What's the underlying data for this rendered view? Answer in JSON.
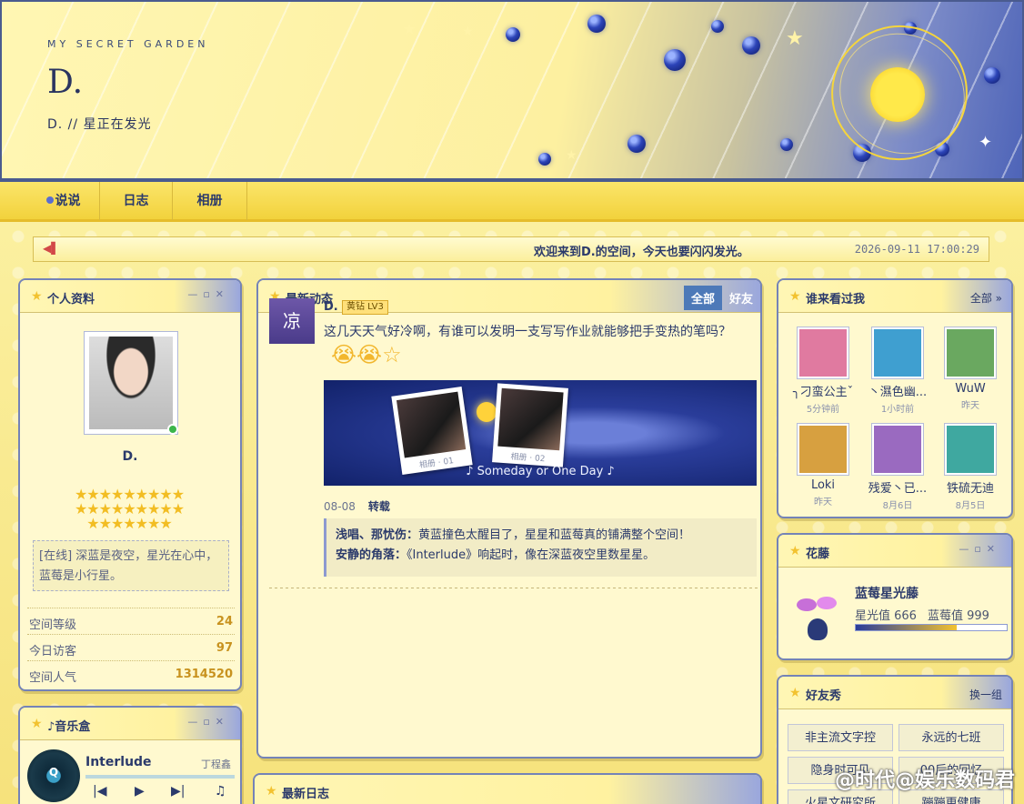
{
  "header": {
    "tagline": "MY SECRET GARDEN",
    "name": "D.",
    "subtitle": "D. // 星正在发光"
  },
  "nav": {
    "items": [
      "说说",
      "日志",
      "相册"
    ]
  },
  "marquee": {
    "text": "欢迎来到D.的空间，今天也要闪闪发光。",
    "datetime": "2026-09-11 17:00:29"
  },
  "profile": {
    "title": "个人资料",
    "name": "D.",
    "stars_row1": "★★★★★★★★★",
    "stars_row2": "★★★★★★★★★",
    "stars_row3": "★★★★★★★",
    "status": "[在线] 深蓝是夜空，星光在心中，蓝莓是小行星。",
    "stats": [
      {
        "label": "空间等级",
        "value": "24"
      },
      {
        "label": "今日访客",
        "value": "97"
      },
      {
        "label": "空间人气",
        "value": "1314520"
      }
    ]
  },
  "feed": {
    "title": "最新动态",
    "tab_all": "全部",
    "tab_friends": "好友",
    "post": {
      "avatar_char": "凉",
      "author": "D.",
      "badge": "黄钻 LV3",
      "text": "这几天天气好冷啊，有谁可以发明一支写写作业就能够把手变热的笔吗？",
      "emojis": "😭😭☆",
      "photo1_caption": "相册 · 01",
      "photo2_caption": "相册 · 02",
      "song": "♪  Someday or One Day  ♪",
      "date": "08-08",
      "action": "转载",
      "comments": [
        {
          "name": "浅唱、那忧伤：",
          "text": "黄蓝撞色太醒目了，星星和蓝莓真的铺满整个空间！"
        },
        {
          "name": "安静的角落：",
          "text": "《Interlude》响起时，像在深蓝夜空里数星星。"
        }
      ]
    }
  },
  "diary": {
    "title": "最新日志"
  },
  "visitors": {
    "title": "谁来看过我",
    "more": "全部 »",
    "items": [
      {
        "name": "╮刁蛮公主ˇ",
        "time": "5分钟前",
        "color": "#e07aa0"
      },
      {
        "name": "丶濕色幽...",
        "time": "1小时前",
        "color": "#3f9fd0"
      },
      {
        "name": "WuW",
        "time": "昨天",
        "color": "#6aa860"
      },
      {
        "name": "Loki",
        "time": "昨天",
        "color": "#d7a040"
      },
      {
        "name": "残爱丶已...",
        "time": "8月6日",
        "color": "#9a6ac0"
      },
      {
        "name": "铁硫无迪",
        "time": "8月5日",
        "color": "#3fa8a0"
      }
    ]
  },
  "vine": {
    "title": "花藤",
    "name": "蓝莓星光藤",
    "starlight_label": "星光值 666",
    "berry_label": "蓝莓值 999",
    "progress": 0.67
  },
  "friends": {
    "title": "好友秀",
    "refresh": "换一组",
    "items": [
      "非主流文字控",
      "永远的七班",
      "隐身时可见",
      "00后的回忆",
      "火星文研究所",
      "蹦蹦更健康"
    ]
  },
  "music": {
    "title": "♪音乐盒",
    "disc_label": "Q",
    "track": "Interlude",
    "artist": "丁程鑫",
    "controls": [
      "|◀",
      "▶",
      "▶|",
      "♫"
    ]
  },
  "watermark": "@时代@娱乐数码君",
  "colors": {
    "accent": "#4d79b8",
    "brand_yellow": "#f6e27c",
    "gold": "#c8921f"
  }
}
